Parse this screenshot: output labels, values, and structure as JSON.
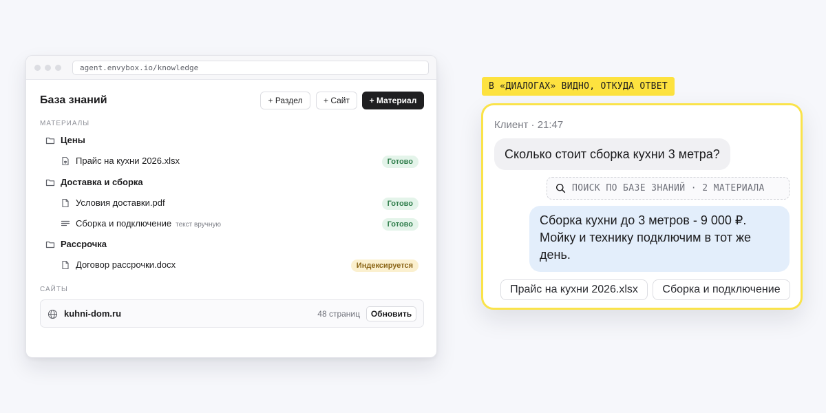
{
  "browser": {
    "url": "agent.envybox.io/knowledge"
  },
  "knowledge": {
    "title": "База знаний",
    "add_section_label": "+ Раздел",
    "add_site_label": "+ Сайт",
    "add_material_label": "+ Материал",
    "materials_label": "Материалы",
    "folders": [
      {
        "name": "Цены",
        "files": [
          {
            "name": "Прайс на кухни 2026.xlsx",
            "icon": "spreadsheet-file-icon",
            "status": "Готово"
          }
        ]
      },
      {
        "name": "Доставка и сборка",
        "files": [
          {
            "name": "Условия доставки.pdf",
            "icon": "document-file-icon",
            "status": "Готово"
          },
          {
            "name": "Сборка и подключение",
            "note": "текст вручную",
            "icon": "text-lines-icon",
            "status": "Готово"
          }
        ]
      },
      {
        "name": "Рассрочка",
        "files": [
          {
            "name": "Договор рассрочки.docx",
            "icon": "document-file-icon",
            "status": "Индексируется"
          }
        ]
      }
    ],
    "sites_label": "Сайты",
    "site": {
      "name": "kuhni-dom.ru",
      "pages": "48 страниц",
      "refresh_label": "Обновить"
    }
  },
  "tag": {
    "text": "В «ДИАЛОГАХ» ВИДНО, ОТКУДА ОТВЕТ"
  },
  "chat": {
    "meta": "Клиент · 21:47",
    "question": "Сколько стоит сборка кухни 3 метра?",
    "search_text": "ПОИСК ПО БАЗЕ ЗНАНИЙ · 2 МАТЕРИАЛА",
    "answer": "Сборка кухни до 3 метров - 9 000 ₽. Мойку и технику подключим в тот же день.",
    "sources": [
      "Прайс на кухни 2026.xlsx",
      "Сборка и подключение"
    ]
  },
  "colors": {
    "accent_yellow": "#fde23f",
    "ready_green": "#2e7d4a",
    "indexing_amber": "#8a6416",
    "answer_bubble": "#e3eefb",
    "primary_button": "#1f1f21"
  }
}
